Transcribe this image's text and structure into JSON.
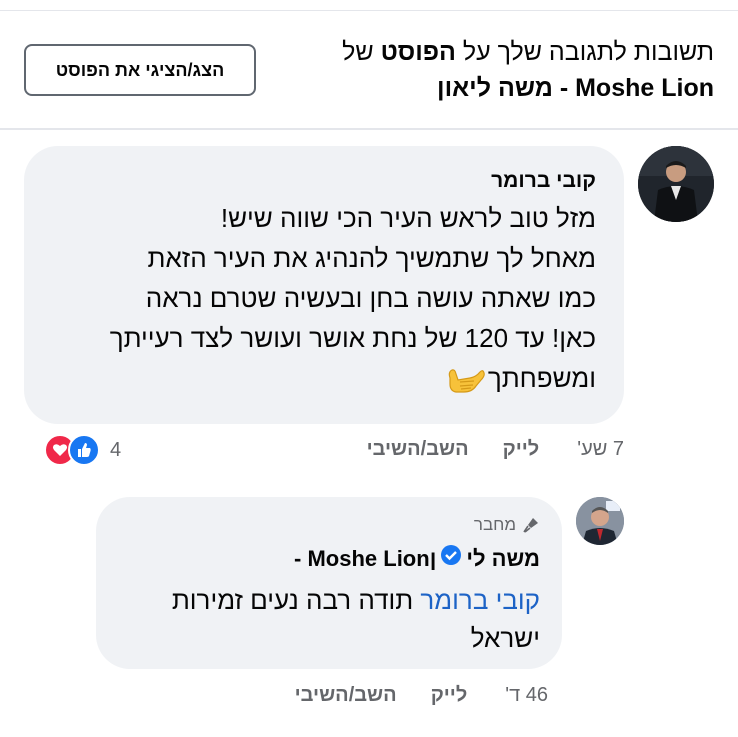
{
  "header": {
    "title_part1": "תשובות לתגובה שלך על ",
    "title_bold": "הפוסט",
    "title_part2": " של",
    "page_name": "Moshe Lion - משה ליאון",
    "show_post_button": "הצג/הציגי את הפוסט"
  },
  "comment": {
    "author": "קובי ברומר",
    "lines": [
      "מזל טוב לראש העיר הכי שווה שיש!",
      "מאחל לך שתמשיך להנהיג את העיר הזאת",
      "כמו שאתה עושה בחן ובעשיה שטרם נראה",
      "כאן! עד 120 של נחת אושר ועושר לצד רעייתך",
      "ומשפחתך"
    ],
    "emoji": "call-me-hand-emoji",
    "time": "7 שע'",
    "like": "לייק",
    "reply": "השב/השיבי",
    "reaction_count": "4",
    "reactions": [
      "like",
      "love"
    ]
  },
  "reply": {
    "badge": "מחבר",
    "author_he_part1": "משה לי",
    "author_he_part2": "ן",
    "author_en": " - Moshe Lion",
    "mention": "קובי ברומר",
    "text_rest": " תודה רבה נעים זמירות",
    "text_line2": "ישראל",
    "time": "46 ד'",
    "like": "לייק",
    "reply": "השב/השיבי"
  },
  "colors": {
    "bubble": "#f0f2f5",
    "mention": "#1d63c6",
    "like_blue": "#1877f2",
    "love_red": "#f02849",
    "meta_gray": "#65676b"
  }
}
